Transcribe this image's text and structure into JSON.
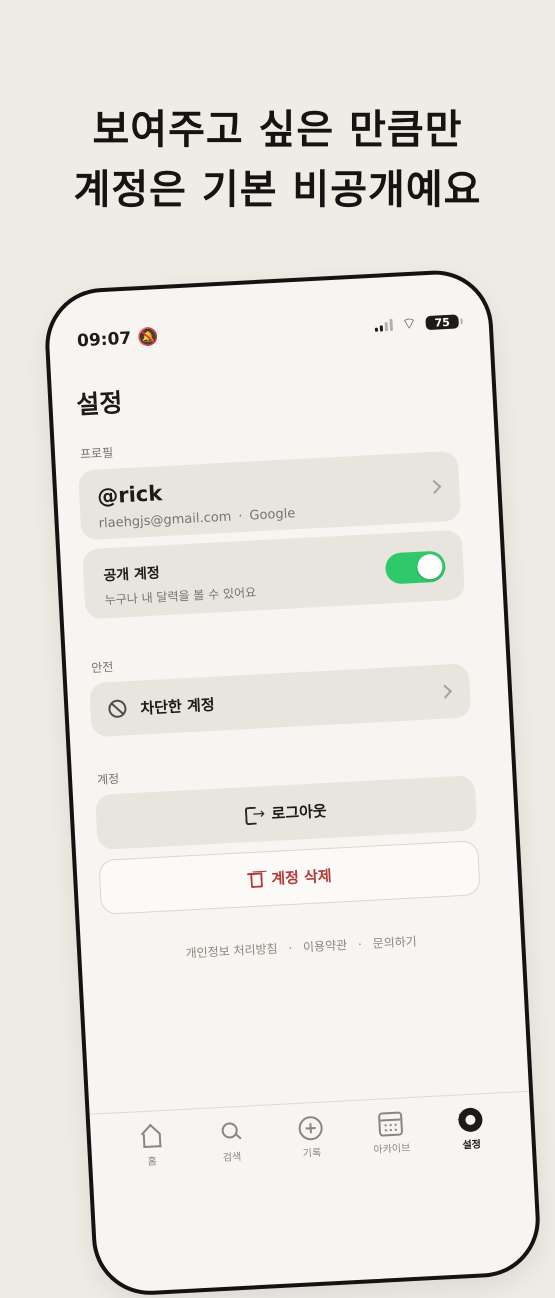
{
  "promo": {
    "headline_line1": "보여주고 싶은 만큼만",
    "headline_line2": "계정은 기본 비공개예요"
  },
  "status_bar": {
    "time": "09:07",
    "battery": "75"
  },
  "screen": {
    "title": "설정"
  },
  "profile_section": {
    "label": "프로필",
    "handle": "@rick",
    "email": "rlaehgjs@gmail.com",
    "separator": "·",
    "provider": "Google"
  },
  "public_account": {
    "title": "공개 계정",
    "description": "누구나 내 달력을 볼 수 있어요",
    "enabled": true
  },
  "safety_section": {
    "label": "안전",
    "blocked_accounts": "차단한 계정"
  },
  "account_section": {
    "label": "계정",
    "logout": "로그아웃",
    "delete_account": "계정 삭제"
  },
  "footer": {
    "privacy_policy": "개인정보 처리방침",
    "separator": "·",
    "terms": "이용약관",
    "contact": "문의하기"
  },
  "tabbar": {
    "items": [
      {
        "label": "홈",
        "icon": "home-icon",
        "active": false
      },
      {
        "label": "검색",
        "icon": "search-icon",
        "active": false
      },
      {
        "label": "기록",
        "icon": "add-icon",
        "active": false
      },
      {
        "label": "아카이브",
        "icon": "calendar-icon",
        "active": false
      },
      {
        "label": "설정",
        "icon": "gear-icon",
        "active": true
      }
    ]
  },
  "colors": {
    "background": "#efebe5",
    "phone_screen": "#f7f5f1",
    "toggle_on": "#2fc86a",
    "danger": "#b33a3a"
  }
}
